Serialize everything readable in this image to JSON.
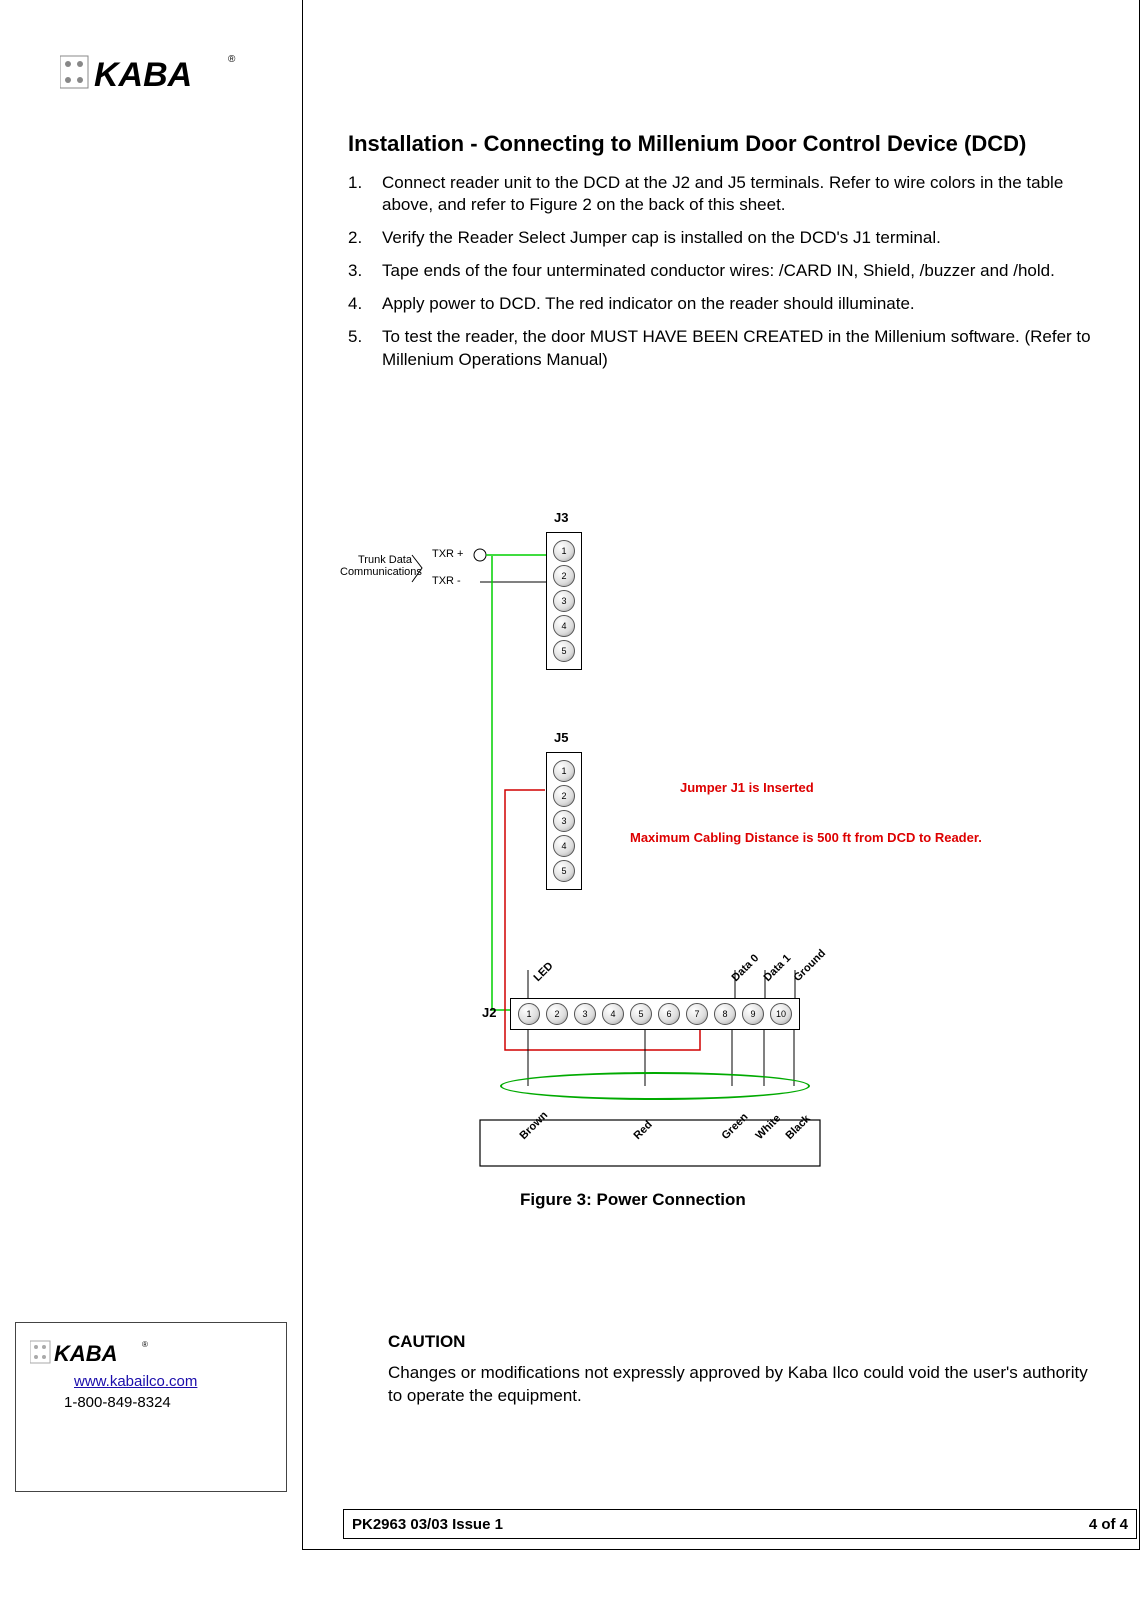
{
  "brand": "KABA",
  "contact": {
    "url": "www.kabailco.com",
    "phone": "1-800-849-8324"
  },
  "heading": "Installation - Connecting to Millenium Door Control Device (DCD)",
  "steps": [
    "Connect reader unit to the DCD at the J2 and J5 terminals. Refer to wire colors in the table above, and refer to Figure 2 on the back of this sheet.",
    "Verify the Reader Select Jumper cap is installed on the DCD's J1 terminal.",
    "Tape ends of the four unterminated conductor wires: /CARD IN, Shield, /buzzer and /hold.",
    "Apply power to DCD. The red indicator on the reader should illuminate.",
    "To test the reader, the door MUST HAVE BEEN CREATED in the Millenium software. (Refer to Millenium Operations Manual)"
  ],
  "diagram": {
    "j3_label": "J3",
    "j5_label": "J5",
    "j2_label": "J2",
    "trunk_label": "Trunk Data\nCommunications",
    "txr_plus": "TXR +",
    "txr_minus": "TXR -",
    "red_note_1": "Jumper J1 is Inserted",
    "red_note_2": "Maximum Cabling Distance is 500 ft from DCD to Reader.",
    "top_rot": [
      "LED",
      "Data 0",
      "Data 1",
      "Ground"
    ],
    "bottom_rot": [
      "Brown",
      "Red",
      "Green",
      "White",
      "Black"
    ],
    "caption": "Figure 3:  Power Connection"
  },
  "caution": {
    "title": "CAUTION",
    "text": "Changes or modifications not expressly approved by Kaba Ilco could void the user's authority to operate the equipment."
  },
  "footer": {
    "left": "PK2963 03/03  Issue 1",
    "right": "4 of 4"
  }
}
